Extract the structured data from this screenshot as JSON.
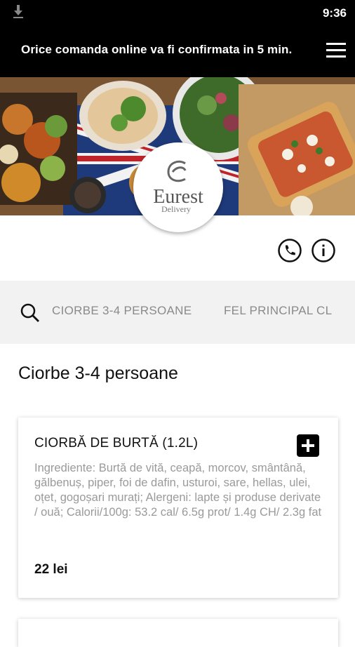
{
  "status_bar": {
    "time": "9:36"
  },
  "header": {
    "title": "Orice comanda online va fi confirmata in 5 min."
  },
  "logo": {
    "brand": "Eurest",
    "sub": "Delivery"
  },
  "categories": [
    {
      "label": "CIORBE 3-4 PERSOANE"
    },
    {
      "label": "FEL PRINCIPAL CL"
    }
  ],
  "section": {
    "title": "Ciorbe 3-4 persoane"
  },
  "items": [
    {
      "name": "CIORBĂ DE BURTĂ (1.2L)",
      "description": "Ingrediente: Burtă de vită, ceapă, morcov, smântână, gălbenuș, piper, foi de dafin, usturoi, sare, hellas, ulei, oțet, gogoșari murați; Alergeni: lapte și produse derivate / ouă; Calorii/100g: 53.2 cal/ 6.5g prot/ 1.4g CH/ 2.3g fat",
      "price": "22 lei"
    }
  ]
}
